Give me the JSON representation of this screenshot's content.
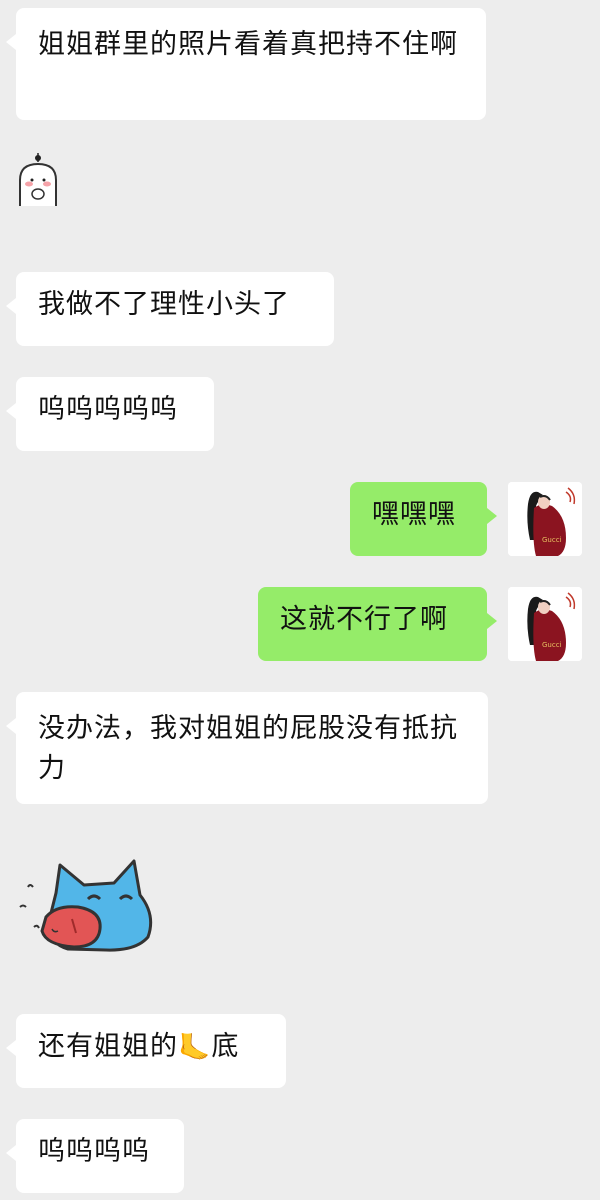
{
  "messages": [
    {
      "side": "left",
      "type": "text",
      "text": "姐姐群里的照片看着真把持不住啊"
    },
    {
      "side": "left",
      "type": "sticker",
      "sticker": "bunny-face-sticker"
    },
    {
      "side": "left",
      "type": "text",
      "text": "我做不了理性小头了"
    },
    {
      "side": "left",
      "type": "text",
      "text": "呜呜呜呜呜"
    },
    {
      "side": "right",
      "type": "text",
      "text": "嘿嘿嘿"
    },
    {
      "side": "right",
      "type": "text",
      "text": "这就不行了啊"
    },
    {
      "side": "left",
      "type": "text",
      "text": "没办法，我对姐姐的屁股没有抵抗力"
    },
    {
      "side": "left",
      "type": "sticker",
      "sticker": "blue-cat-tongue-sticker"
    },
    {
      "side": "left",
      "type": "text",
      "text_before": "还有姐姐的",
      "emoji": "🦶",
      "text_after": "底"
    },
    {
      "side": "left",
      "type": "text",
      "text": "呜呜呜呜"
    }
  ],
  "icons": {
    "avatar": "user-avatar-icon",
    "foot": "foot-emoji-icon"
  },
  "colors": {
    "background": "#ededed",
    "left_bubble": "#ffffff",
    "right_bubble": "#95ec69"
  }
}
